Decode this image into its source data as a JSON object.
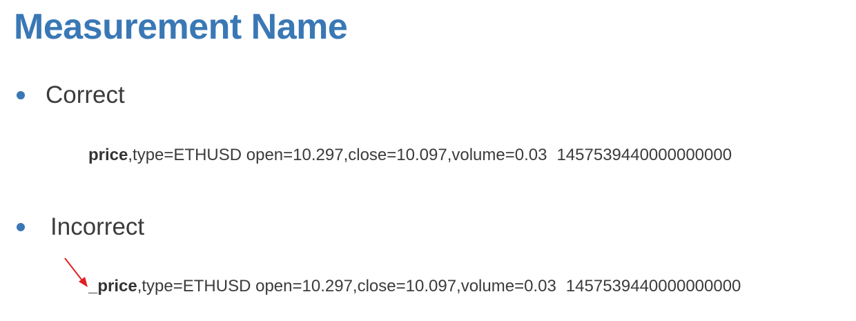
{
  "page": {
    "title": "Measurement Name"
  },
  "sections": {
    "correct": {
      "heading": "Correct",
      "example": {
        "measurement": "price",
        "rest": ",type=ETHUSD open=10.297,close=10.097,volume=0.03",
        "timestamp": "1457539440000000000"
      }
    },
    "incorrect": {
      "heading": "Incorrect",
      "example": {
        "measurement": "_price",
        "rest": ",type=ETHUSD open=10.297,close=10.097,volume=0.03",
        "timestamp": "1457539440000000000"
      }
    }
  },
  "colors": {
    "title": "#3a78b5",
    "bullet": "#3a78b5",
    "text": "#3b3b3b",
    "arrow": "#e02020"
  },
  "icons": {
    "bullet": "bullet-dot-icon",
    "pointer": "red-arrow-icon"
  }
}
